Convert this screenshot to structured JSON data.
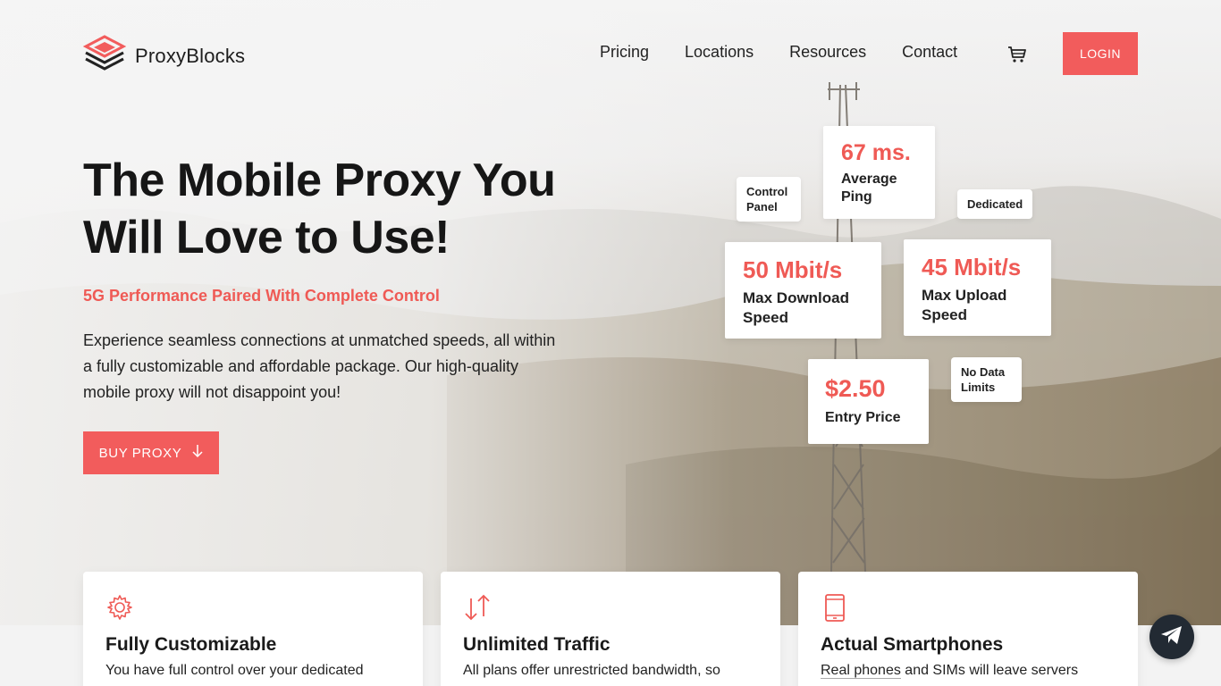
{
  "brand": {
    "name": "ProxyBlocks",
    "accent": "#f25c5c"
  },
  "nav": {
    "items": [
      "Pricing",
      "Locations",
      "Resources",
      "Contact"
    ],
    "cart_icon": "cart-icon",
    "login_label": "LOGIN"
  },
  "hero": {
    "title": "The Mobile Proxy You Will Love to Use!",
    "subtitle": "5G Performance Paired With Complete Control",
    "description": "Experience seamless connections at unmatched speeds, all within a fully customizable and affordable package. Our high-quality mobile proxy will not disappoint you!",
    "cta_label": "BUY PROXY"
  },
  "stats": {
    "ping": {
      "value": "67 ms.",
      "label": "Average Ping"
    },
    "download": {
      "value": "50 Mbit/s",
      "label": "Max Download Speed"
    },
    "upload": {
      "value": "45 Mbit/s",
      "label": "Max Upload Speed"
    },
    "price": {
      "value": "$2.50",
      "label": "Entry Price"
    }
  },
  "tags": {
    "control_panel": "Control Panel",
    "dedicated": "Dedicated",
    "no_data_limits": "No Data Limits"
  },
  "features": [
    {
      "icon": "gear-icon",
      "title": "Fully Customizable",
      "text": "You have full control over your dedicated"
    },
    {
      "icon": "arrows-icon",
      "title": "Unlimited Traffic",
      "text": "All plans offer unrestricted bandwidth, so"
    },
    {
      "icon": "smartphone-icon",
      "title": "Actual Smartphones",
      "text_link": "Real phones",
      "text_rest": " and SIMs will leave servers"
    }
  ],
  "chat_icon": "telegram-icon"
}
